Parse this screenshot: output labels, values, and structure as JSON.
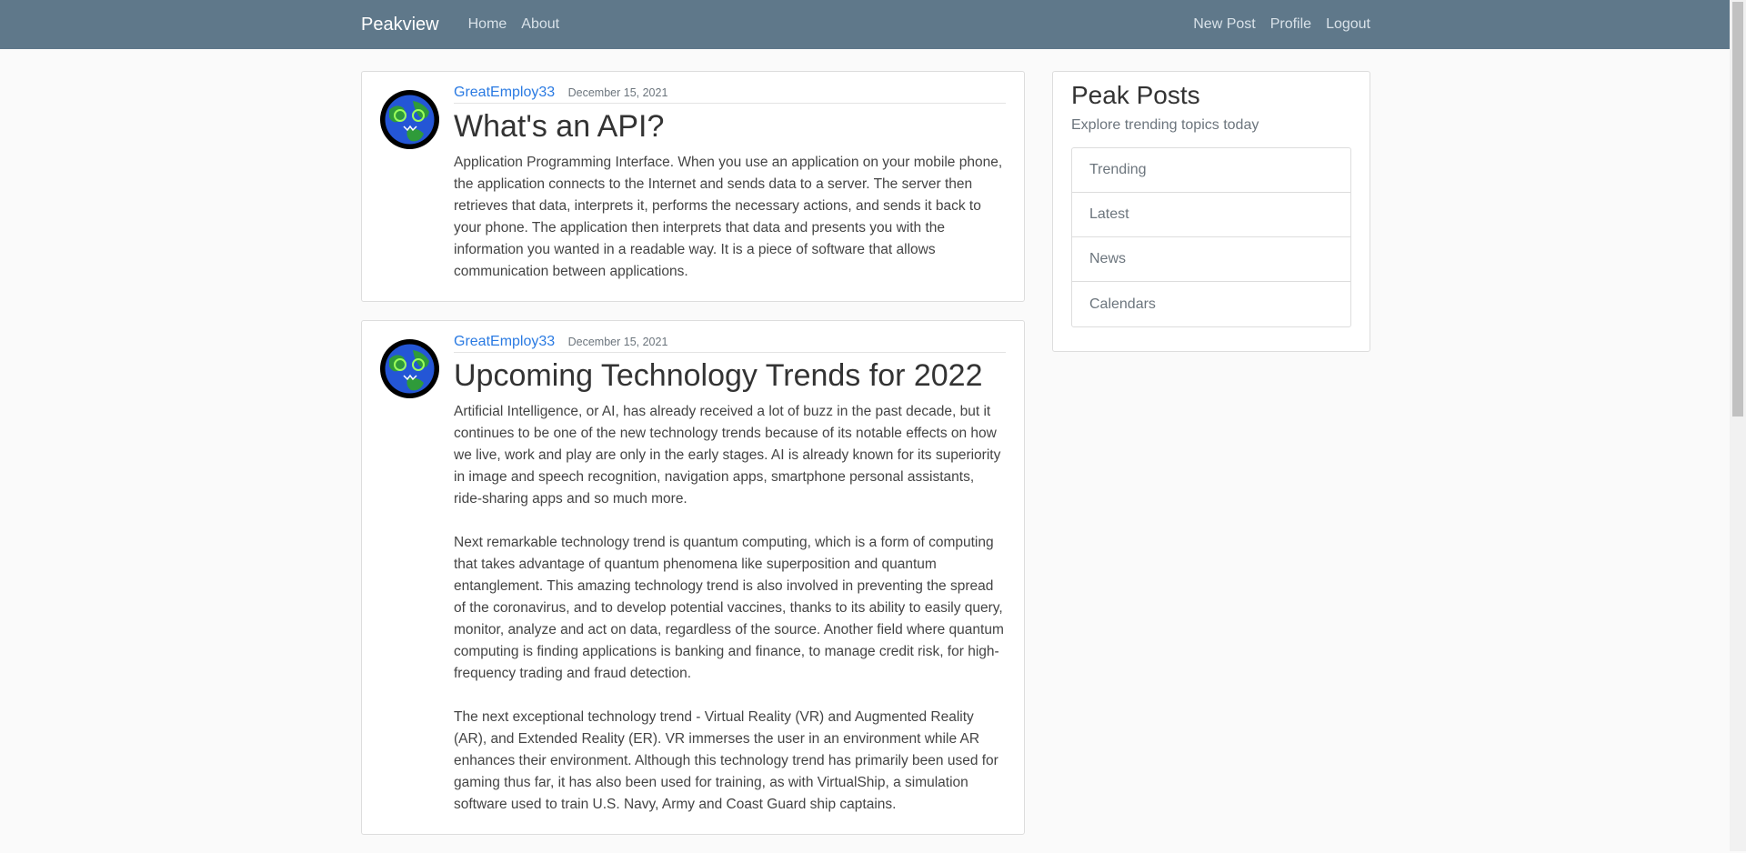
{
  "nav": {
    "brand": "Peakview",
    "left_links": [
      "Home",
      "About"
    ],
    "right_links": [
      "New Post",
      "Profile",
      "Logout"
    ]
  },
  "posts": [
    {
      "author": "GreatEmploy33",
      "date": "December 15, 2021",
      "title": "What's an API?",
      "paragraphs": [
        "Application Programming Interface. When you use an application on your mobile phone, the application connects to the Internet and sends data to a server. The server then retrieves that data, interprets it, performs the necessary actions, and sends it back to your phone. The application then interprets that data and presents you with the information you wanted in a readable way. It is a piece of software that allows communication between applications."
      ]
    },
    {
      "author": "GreatEmploy33",
      "date": "December 15, 2021",
      "title": "Upcoming Technology Trends for 2022",
      "paragraphs": [
        "Artificial Intelligence, or AI, has already received a lot of buzz in the past decade, but it continues to be one of the new technology trends because of its notable effects on how we live, work and play are only in the early stages. AI is already known for its superiority in image and speech recognition, navigation apps, smartphone personal assistants, ride-sharing apps and so much more.",
        "Next remarkable technology trend is quantum computing, which is a form of computing that takes advantage of quantum phenomena like superposition and quantum entanglement. This amazing technology trend is also involved in preventing the spread of the coronavirus, and to develop potential vaccines, thanks to its ability to easily query, monitor, analyze and act on data, regardless of the source. Another field where quantum computing is finding applications is banking and finance, to manage credit risk, for high-frequency trading and fraud detection.",
        "The next exceptional technology trend - Virtual Reality (VR) and Augmented Reality (AR), and Extended Reality (ER). VR immerses the user in an environment while AR enhances their environment. Although this technology trend has primarily been used for gaming thus far, it has also been used for training, as with VirtualShip, a simulation software used to train U.S. Navy, Army and Coast Guard ship captains."
      ]
    }
  ],
  "sidebar": {
    "title": "Peak Posts",
    "subtitle": "Explore trending topics today",
    "items": [
      "Trending",
      "Latest",
      "News",
      "Calendars"
    ]
  },
  "colors": {
    "navbar": "#5f788a",
    "link": "#2a7ae2"
  }
}
